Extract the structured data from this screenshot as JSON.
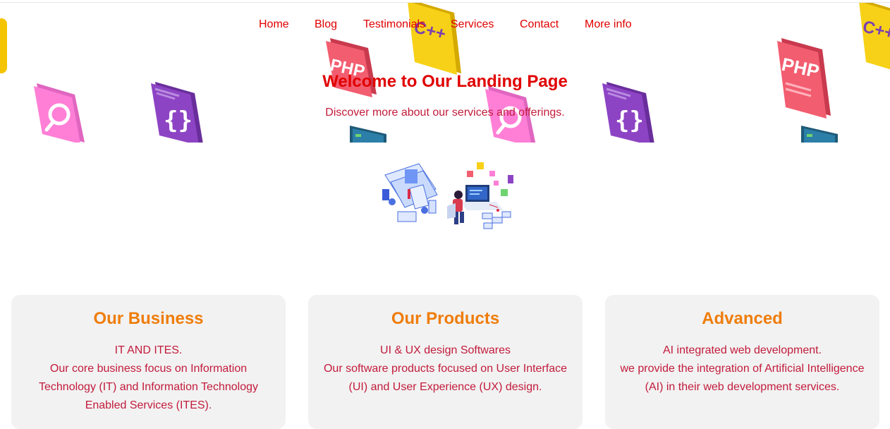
{
  "nav": {
    "items": [
      "Home",
      "Blog",
      "Testimonials",
      "Services",
      "Contact",
      "More info"
    ]
  },
  "hero": {
    "title": "Welcome to Our Landing Page",
    "subtitle": "Discover more about our services and offerings.",
    "tiles": {
      "cpp": "C++",
      "php": "PHP",
      "braces": "{}"
    }
  },
  "cards": [
    {
      "title": "Our Business",
      "lines": [
        "IT AND ITES.",
        "Our core business focus on Information",
        "Technology (IT) and Information Technology",
        "Enabled Services (ITES)."
      ]
    },
    {
      "title": "Our Products",
      "lines": [
        "UI & UX design Softwares",
        "Our software products focused on User Interface",
        "(UI) and User Experience (UX) design."
      ]
    },
    {
      "title": "Advanced",
      "lines": [
        "AI integrated web development.",
        "we provide the integration of Artificial Intelligence",
        "(AI) in their web development services."
      ]
    }
  ],
  "colors": {
    "nav_link": "#e00000",
    "title": "#e00000",
    "body_text": "#c21b3b",
    "card_title": "#ef7d0b",
    "card_bg": "#f2f2f2"
  }
}
